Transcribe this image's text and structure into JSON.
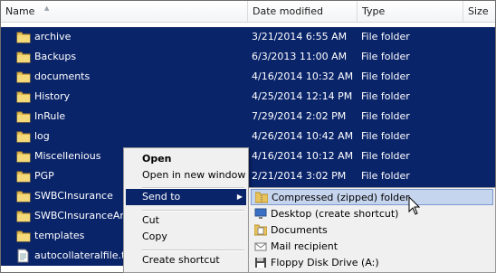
{
  "header": {
    "name": "Name",
    "date_modified": "Date modified",
    "type": "Type",
    "size": "Size"
  },
  "rows": [
    {
      "name": "archive",
      "date": "3/21/2014 6:55 AM",
      "type": "File folder",
      "icon": "folder-icon"
    },
    {
      "name": "Backups",
      "date": "6/3/2013 11:00 AM",
      "type": "File folder",
      "icon": "folder-icon"
    },
    {
      "name": "documents",
      "date": "4/16/2014 10:32 AM",
      "type": "File folder",
      "icon": "folder-icon"
    },
    {
      "name": "History",
      "date": "4/25/2014 12:14 PM",
      "type": "File folder",
      "icon": "folder-icon"
    },
    {
      "name": "InRule",
      "date": "7/29/2014 2:02 PM",
      "type": "File folder",
      "icon": "folder-icon"
    },
    {
      "name": "log",
      "date": "4/26/2014 10:42 AM",
      "type": "File folder",
      "icon": "folder-icon"
    },
    {
      "name": "Miscellenious",
      "date": "4/16/2014 10:12 AM",
      "type": "File folder",
      "icon": "folder-icon"
    },
    {
      "name": "PGP",
      "date": "2/21/2014 3:02 PM",
      "type": "File folder",
      "icon": "folder-icon"
    },
    {
      "name": "SWBCInsurance",
      "date": "",
      "type": "",
      "icon": "folder-icon"
    },
    {
      "name": "SWBCInsuranceArch",
      "date": "",
      "type": "",
      "icon": "folder-icon"
    },
    {
      "name": "templates",
      "date": "",
      "type": "",
      "icon": "folder-icon"
    },
    {
      "name": "autocollateralfile.txt",
      "date": "",
      "type": "",
      "icon": "text-file-icon"
    }
  ],
  "context_menu": {
    "open": "Open",
    "open_new_window": "Open in new window",
    "send_to": "Send to",
    "cut": "Cut",
    "copy": "Copy",
    "create_shortcut": "Create shortcut"
  },
  "send_to_menu": [
    {
      "label": "Compressed (zipped) folder",
      "icon": "zip-folder-icon"
    },
    {
      "label": "Desktop (create shortcut)",
      "icon": "desktop-icon"
    },
    {
      "label": "Documents",
      "icon": "documents-icon"
    },
    {
      "label": "Mail recipient",
      "icon": "mail-icon"
    },
    {
      "label": "Floppy Disk Drive (A:)",
      "icon": "floppy-icon"
    }
  ],
  "colors": {
    "selection": "#0a246a",
    "submenu_highlight": "#c6d5ee",
    "folder": "#e8c25a"
  }
}
